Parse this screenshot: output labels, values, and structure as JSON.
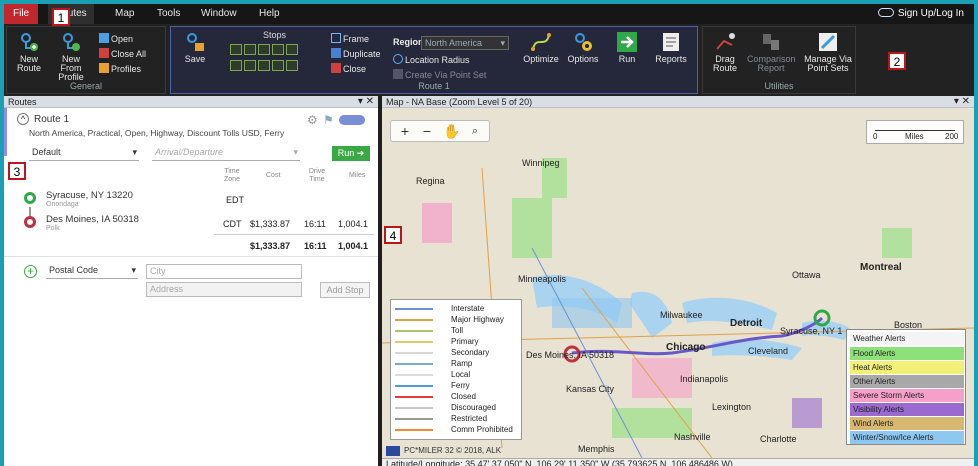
{
  "menu": {
    "file": "File",
    "routes": "Routes",
    "map": "Map",
    "tools": "Tools",
    "window": "Window",
    "help": "Help",
    "signup": "Sign Up/Log In"
  },
  "callouts": [
    "1",
    "2",
    "3",
    "4"
  ],
  "ribbon": {
    "general": {
      "name": "General",
      "new_route": "New Route",
      "new_from_profile": "New From Profile",
      "open": "Open",
      "close_all": "Close All",
      "profiles": "Profiles"
    },
    "route1": {
      "name": "Route 1",
      "save": "Save",
      "stops": "Stops",
      "frame": "Frame",
      "duplicate": "Duplicate",
      "close": "Close",
      "region_label": "Region",
      "region_value": "North America",
      "location_radius": "Location Radius",
      "create_via": "Create Via Point Set",
      "optimize": "Optimize",
      "options": "Options",
      "run": "Run",
      "reports": "Reports"
    },
    "utilities": {
      "name": "Utilities",
      "drag_route": "Drag Route",
      "comparison_report": "Comparison Report",
      "manage_via": "Manage Via Point Sets"
    }
  },
  "routes_panel": {
    "header": "Routes",
    "route_name": "Route 1",
    "route_desc": "North America, Practical, Open, Highway, Discount Tolls USD, Ferry",
    "profile": "Default",
    "arrival_placeholder": "Arrival/Departure",
    "run_label": "Run",
    "columns": [
      "Time Zone",
      "Cost",
      "Drive Time",
      "Miles"
    ],
    "stops": [
      {
        "name": "Syracuse, NY 13220",
        "county": "Onondaga",
        "tz": "EDT",
        "cost": "",
        "drive": "",
        "miles": ""
      },
      {
        "name": "Des Moines, IA 50318",
        "county": "Polk",
        "tz": "CDT",
        "cost": "$1,333.87",
        "drive": "16:11",
        "miles": "1,004.1"
      }
    ],
    "totals": {
      "cost": "$1,333.87",
      "drive": "16:11",
      "miles": "1,004.1"
    },
    "add_stop": {
      "type": "Postal Code",
      "city_placeholder": "City",
      "address_placeholder": "Address",
      "button": "Add Stop"
    }
  },
  "map_panel": {
    "header": "Map - NA Base (Zoom Level 5 of 20)",
    "scale_label": "Miles",
    "scale_start": "0",
    "scale_end": "200",
    "labels": {
      "regina": "Regina",
      "winnipeg": "Winnipeg",
      "minneapolis": "Minneapolis",
      "ottawa": "Ottawa",
      "montreal": "Montreal",
      "milwaukee": "Milwaukee",
      "detroit": "Detroit",
      "syracuse": "Syracuse, NY 1",
      "chicago": "Chicago",
      "cleveland": "Cleveland",
      "desmoines": "Des Moines, IA 50318",
      "indianapolis": "Indianapolis",
      "kansascity": "Kansas City",
      "lexington": "Lexington",
      "nashville": "Nashville",
      "charlotte": "Charlotte",
      "memphis": "Memphis",
      "boston": "Boston"
    },
    "legend": [
      {
        "label": "Interstate",
        "color": "#6b8fd4"
      },
      {
        "label": "Major Highway",
        "color": "#e0a04a"
      },
      {
        "label": "Toll",
        "color": "#a9c46a"
      },
      {
        "label": "Primary",
        "color": "#e4c96a"
      },
      {
        "label": "Secondary",
        "color": "#d6d6d6"
      },
      {
        "label": "Ramp",
        "color": "#7aa9d8"
      },
      {
        "label": "Local",
        "color": "#dddddd"
      },
      {
        "label": "Ferry",
        "color": "#4fa0d0"
      },
      {
        "label": "Closed",
        "color": "#e33b3b"
      },
      {
        "label": "Discouraged",
        "color": "#c8c8c8"
      },
      {
        "label": "Restricted",
        "color": "#999999"
      },
      {
        "label": "Comm Prohibited",
        "color": "#f28a3a"
      }
    ],
    "alerts_title": "Weather Alerts",
    "alerts": [
      {
        "label": "Flood Alerts",
        "color": "#8ee07a"
      },
      {
        "label": "Heat Alerts",
        "color": "#f3f07a"
      },
      {
        "label": "Other Alerts",
        "color": "#a8a8a8"
      },
      {
        "label": "Severe Storm Alerts",
        "color": "#f5a0c8"
      },
      {
        "label": "Visibility Alerts",
        "color": "#9a6ad0"
      },
      {
        "label": "Wind Alerts",
        "color": "#d8b870"
      },
      {
        "label": "Winter/Snow/Ice Alerts",
        "color": "#8ec8f0"
      }
    ],
    "copyright": "PC*MILER 32 © 2018, ALK",
    "status": "Latitude/Longitude: 35 47' 37.050\" N, 106 29' 11.350\" W (35.793625 N, 106.486486 W)"
  }
}
